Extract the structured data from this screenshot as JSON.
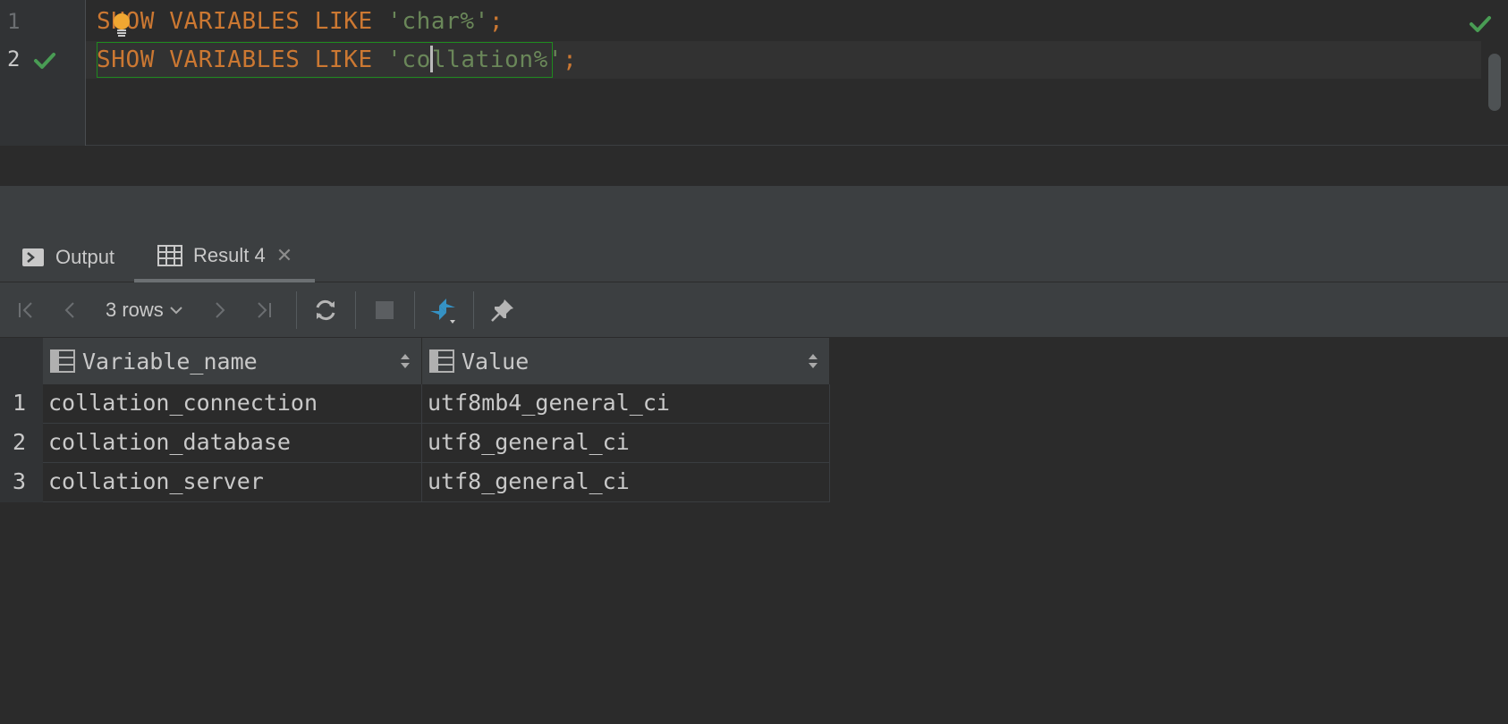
{
  "editor": {
    "lines": [
      {
        "number": "1",
        "keywords": "SHOW VARIABLES LIKE ",
        "string": "'char%'",
        "terminator": ";"
      },
      {
        "number": "2",
        "keywords": "SHOW VARIABLES LIKE ",
        "string_before_caret": "'co",
        "string_after_caret": "llation%'",
        "terminator": ";"
      }
    ],
    "colors": {
      "keyword": "#cc7832",
      "string": "#6a8759",
      "success": "#499c54",
      "bulb": "#f0a732"
    }
  },
  "results_panel": {
    "tabs": [
      {
        "label": "Output",
        "icon": "console-icon"
      },
      {
        "label": "Result 4",
        "icon": "table-icon",
        "close_glyph": "✕",
        "active": true
      }
    ],
    "toolbar": {
      "rows_label": "3 rows",
      "buttons": [
        "first-page-icon",
        "previous-page-icon",
        "next-page-icon",
        "last-page-icon",
        "refresh-icon",
        "stop-icon",
        "compare-icon",
        "pin-icon"
      ]
    },
    "grid": {
      "columns": [
        "Variable_name",
        "Value"
      ],
      "rows": [
        {
          "n": "1",
          "cells": [
            "collation_connection",
            "utf8mb4_general_ci"
          ]
        },
        {
          "n": "2",
          "cells": [
            "collation_database",
            "utf8_general_ci"
          ]
        },
        {
          "n": "3",
          "cells": [
            "collation_server",
            "utf8_general_ci"
          ]
        }
      ]
    }
  }
}
